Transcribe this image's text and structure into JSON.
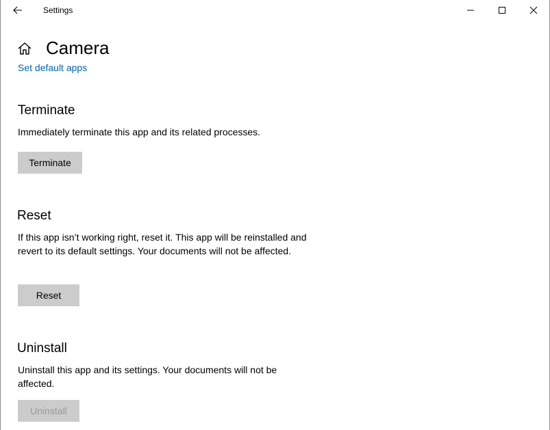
{
  "window": {
    "title": "Settings"
  },
  "header": {
    "title": "Camera",
    "link": "Set default apps"
  },
  "sections": {
    "terminate": {
      "heading": "Terminate",
      "description": "Immediately terminate this app and its related processes.",
      "button": "Terminate"
    },
    "reset": {
      "heading": "Reset",
      "description": "If this app isn’t working right, reset it. This app will be reinstalled and revert to its default settings. Your documents will not be affected.",
      "button": "Reset"
    },
    "uninstall": {
      "heading": "Uninstall",
      "description": "Uninstall this app and its settings. Your documents will not be affected.",
      "button": "Uninstall",
      "button_disabled": true
    }
  },
  "icons": {
    "back": "back-arrow-icon",
    "home": "home-icon",
    "minimize": "minimize-icon",
    "maximize": "maximize-icon",
    "close": "close-icon"
  },
  "colors": {
    "link": "#0063b1",
    "button_bg": "#cccccc",
    "disabled_text": "#999999"
  }
}
